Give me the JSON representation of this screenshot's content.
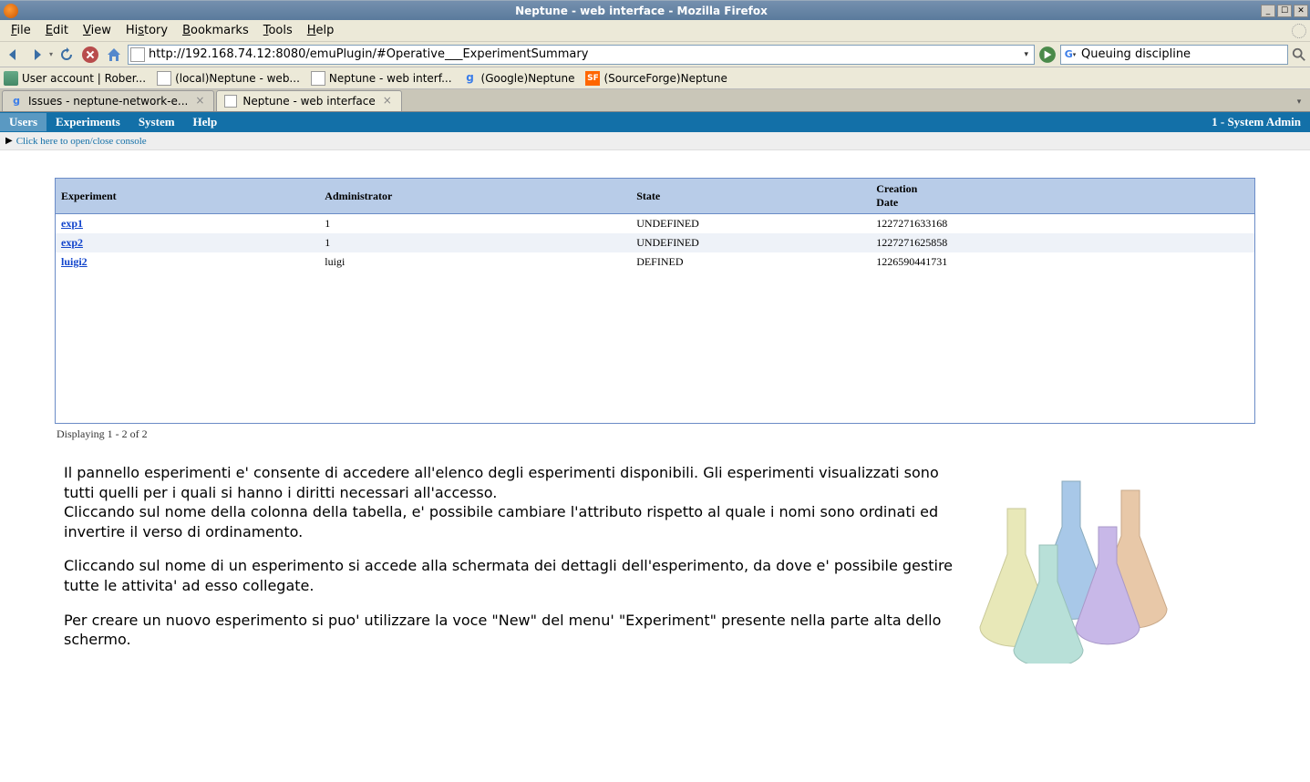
{
  "window": {
    "title": "Neptune - web interface - Mozilla Firefox"
  },
  "browserMenu": [
    "File",
    "Edit",
    "View",
    "History",
    "Bookmarks",
    "Tools",
    "Help"
  ],
  "url": "http://192.168.74.12:8080/emuPlugin/#Operative___ExperimentSummary",
  "search": {
    "value": "Queuing discipline",
    "engine_icon": "G"
  },
  "bookmarks": [
    {
      "label": "User account | Rober...",
      "icon": "person"
    },
    {
      "label": "(local)Neptune - web...",
      "icon": "page"
    },
    {
      "label": "Neptune - web interf...",
      "icon": "page"
    },
    {
      "label": "(Google)Neptune",
      "icon": "g"
    },
    {
      "label": "(SourceForge)Neptune",
      "icon": "sf"
    }
  ],
  "tabs": [
    {
      "label": "Issues - neptune-network-e...",
      "active": false
    },
    {
      "label": "Neptune - web interface",
      "active": true
    }
  ],
  "appMenu": {
    "items": [
      "Users",
      "Experiments",
      "System",
      "Help"
    ],
    "active": "Users",
    "right": "1 - System Admin"
  },
  "consoleToggle": "Click here to open/close console",
  "table": {
    "headers": [
      "Experiment",
      "Administrator",
      "State",
      "Creation\nDate"
    ],
    "rows": [
      {
        "experiment": "exp1",
        "admin": "1",
        "state": "UNDEFINED",
        "date": "1227271633168"
      },
      {
        "experiment": "exp2",
        "admin": "1",
        "state": "UNDEFINED",
        "date": "1227271625858"
      },
      {
        "experiment": "luigi2",
        "admin": "luigi",
        "state": "DEFINED",
        "date": "1226590441731"
      }
    ],
    "pager": "Displaying 1 - 2 of 2"
  },
  "help": {
    "p1": "Il pannello esperimenti e' consente di accedere all'elenco degli esperimenti disponibili. Gli esperimenti visualizzati sono tutti quelli per i quali si hanno i diritti necessari all'accesso.",
    "p1b": "Cliccando sul nome della colonna della tabella, e' possibile cambiare l'attributo rispetto al quale i nomi sono ordinati ed invertire il verso di ordinamento.",
    "p2": "Cliccando sul nome di un esperimento si accede alla schermata dei dettagli dell'esperimento, da dove e' possibile gestire tutte le attivita' ad esso collegate.",
    "p3": "Per creare un nuovo esperimento si puo' utilizzare la voce \"New\" del menu' \"Experiment\" presente nella parte alta dello schermo."
  }
}
